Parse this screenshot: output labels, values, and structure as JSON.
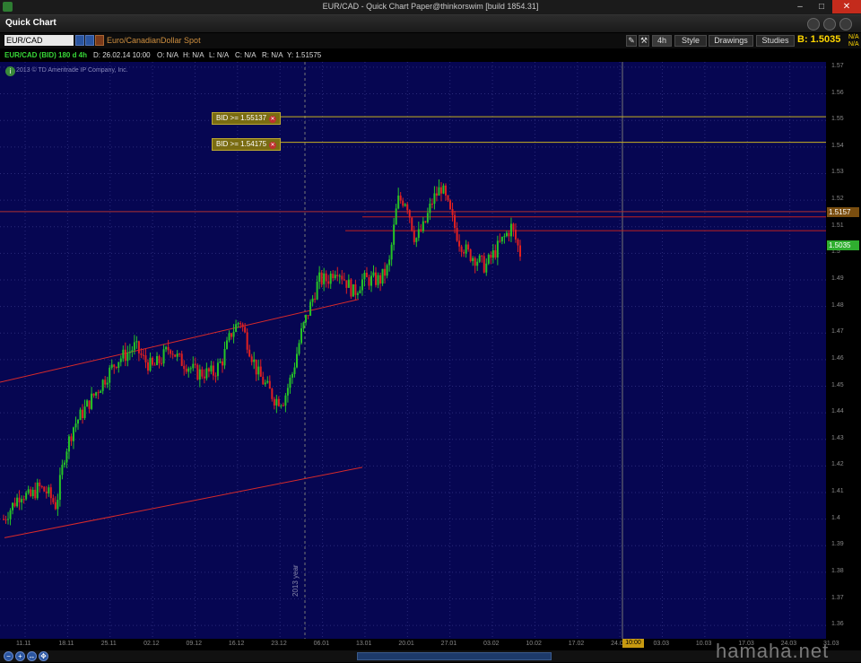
{
  "window": {
    "title": "EUR/CAD - Quick Chart Paper@thinkorswim [build 1854.31]"
  },
  "header": {
    "title": "Quick Chart"
  },
  "toolbar": {
    "symbol": "EUR/CAD",
    "description": "Euro/CanadianDollar Spot",
    "aggregation": "4h",
    "style_label": "Style",
    "drawings_label": "Drawings",
    "studies_label": "Studies",
    "bid_label": "B: 1.5035",
    "na1": "N/A",
    "na2": "N/A"
  },
  "infobar": {
    "chart_id": "EUR/CAD (BID) 180 d 4h",
    "date": "D: 26.02.14 10:00",
    "open": "O: N/A",
    "high": "H: N/A",
    "low": "L: N/A",
    "close": "C: N/A",
    "range": "R: N/A",
    "cursor_y": "Y: 1.51575"
  },
  "copyright": "2013 © TD Ameritrade IP Company, Inc.",
  "alerts": [
    {
      "label": "BID >= 1.55137",
      "x": "✕"
    },
    {
      "label": "BID >= 1.54175",
      "x": "✕"
    }
  ],
  "annotations": {
    "year_marker": "2013 year"
  },
  "watermark": "hamaha.net",
  "colors": {
    "plot_bg": "#060652",
    "up": "#26c426",
    "down": "#e02020",
    "trendline": "#d82a2a",
    "alert_line": "#c8b020"
  },
  "chart_data": {
    "type": "candlestick",
    "symbol": "EUR/CAD",
    "ylim": [
      1.355,
      1.572
    ],
    "y_ticks": [
      "1.57",
      "1.56",
      "1.55",
      "1.54",
      "1.53",
      "1.52",
      "1.51",
      "1.5",
      "1.49",
      "1.48",
      "1.47",
      "1.46",
      "1.45",
      "1.44",
      "1.43",
      "1.42",
      "1.41",
      "1.4",
      "1.39",
      "1.38",
      "1.37",
      "1.36"
    ],
    "x_ticks": [
      "11.11",
      "18.11",
      "25.11",
      "02.12",
      "09.12",
      "16.12",
      "23.12",
      "06.01",
      "13.01",
      "20.01",
      "27.01",
      "03.02",
      "10.02",
      "17.02",
      "24.02",
      "03.03",
      "10.03",
      "17.03",
      "24.03",
      "31.03"
    ],
    "x_current": "10:00",
    "price_tags": [
      {
        "value": "1.5157",
        "role": "cursor"
      },
      {
        "value": "1.5035",
        "role": "bid"
      }
    ],
    "alert_levels": [
      1.55137,
      1.54175
    ],
    "path": [
      1.4,
      1.405,
      1.41,
      1.408,
      1.412,
      1.41,
      1.405,
      1.425,
      1.435,
      1.44,
      1.445,
      1.45,
      1.455,
      1.46,
      1.462,
      1.465,
      1.46,
      1.457,
      1.46,
      1.465,
      1.46,
      1.458,
      1.455,
      1.455,
      1.455,
      1.46,
      1.47,
      1.475,
      1.465,
      1.455,
      1.45,
      1.445,
      1.445,
      1.455,
      1.47,
      1.48,
      1.49,
      1.49,
      1.495,
      1.49,
      1.485,
      1.49,
      1.49,
      1.49,
      1.495,
      1.52,
      1.52,
      1.505,
      1.51,
      1.52,
      1.525,
      1.515,
      1.505,
      1.5,
      1.498,
      1.495,
      1.5,
      1.505,
      1.51,
      1.5
    ]
  }
}
